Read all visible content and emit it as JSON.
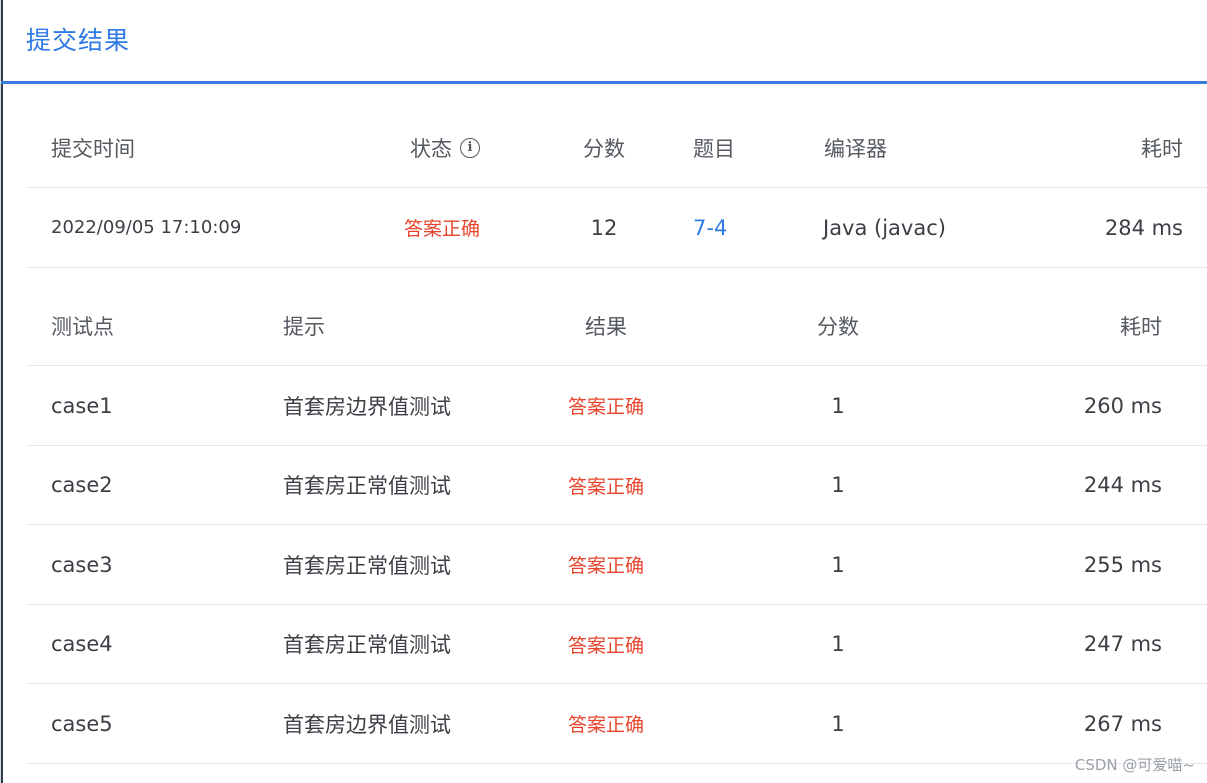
{
  "dialog": {
    "title": "提交结果"
  },
  "summary": {
    "headers": {
      "time": "提交时间",
      "status": "状态",
      "score": "分数",
      "problem": "题目",
      "compiler": "编译器",
      "duration": "耗时"
    },
    "row": {
      "time": "2022/09/05 17:10:09",
      "status": "答案正确",
      "score": "12",
      "problem": "7-4",
      "compiler": "Java (javac)",
      "duration": "284 ms"
    }
  },
  "cases": {
    "headers": {
      "case": "测试点",
      "hint": "提示",
      "result": "结果",
      "score": "分数",
      "duration": "耗时"
    },
    "rows": [
      {
        "case": "case1",
        "hint": "首套房边界值测试",
        "result": "答案正确",
        "score": "1",
        "duration": "260 ms"
      },
      {
        "case": "case2",
        "hint": "首套房正常值测试",
        "result": "答案正确",
        "score": "1",
        "duration": "244 ms"
      },
      {
        "case": "case3",
        "hint": "首套房正常值测试",
        "result": "答案正确",
        "score": "1",
        "duration": "255 ms"
      },
      {
        "case": "case4",
        "hint": "首套房正常值测试",
        "result": "答案正确",
        "score": "1",
        "duration": "247 ms"
      },
      {
        "case": "case5",
        "hint": "首套房边界值测试",
        "result": "答案正确",
        "score": "1",
        "duration": "267 ms"
      }
    ]
  },
  "watermark": "CSDN @可爱喵~",
  "colors": {
    "accent": "#2f7ae5",
    "success_text": "#e8452c",
    "divider": "#e6e8ec"
  },
  "icons": {
    "status_info": "info-circle-icon"
  }
}
